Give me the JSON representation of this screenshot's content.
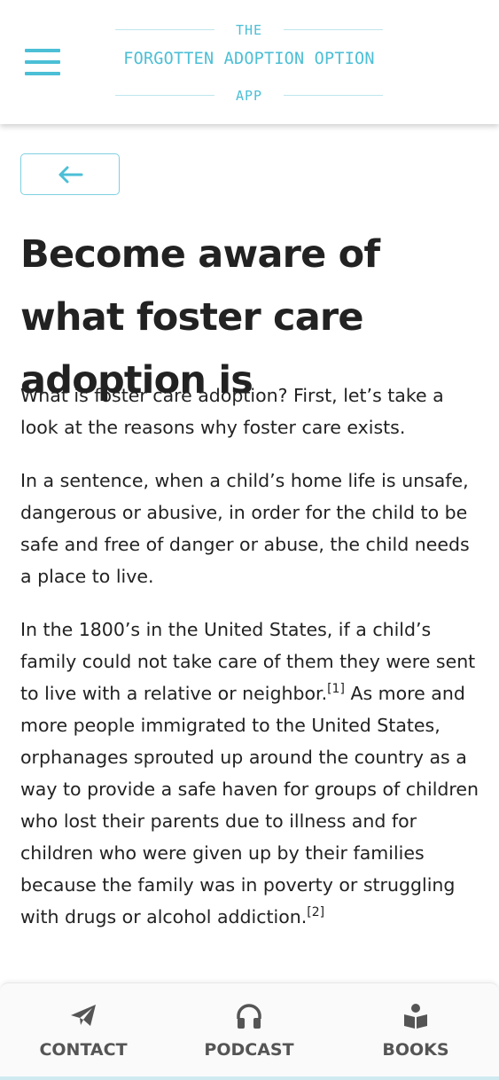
{
  "header": {
    "logo_top": "THE",
    "logo_main": "FORGOTTEN ADOPTION OPTION",
    "logo_bottom": "APP",
    "accent_color": "#4bbfd6",
    "menu_icon": "hamburger-menu-icon"
  },
  "back_button": {
    "icon": "arrow-left-icon"
  },
  "article": {
    "title": "Become aware of what foster care adoption is",
    "p1": "What is foster care adoption? First, let’s take a look at the reasons why foster care exists.",
    "p2": "In a sentence, when a child’s home life is unsafe, dangerous or abusive, in order for the child to be safe and free of danger or abuse, the child needs a place to live.",
    "p3_part1": "In the 1800’s in the United States, if a child’s family could not take care of them they were sent to live with a relative or neighbor.",
    "p3_ref1": "[1]",
    "p3_part2": " As more and more people immigrated to the United States, orphanages sprouted up around the country as a way to provide a safe haven for groups of children who lost their parents due to illness and for children who were given up by their families because the family was in poverty or struggling with drugs or alcohol addiction.",
    "p3_ref2": "[2]"
  },
  "bottom_nav": {
    "contact": {
      "label": "CONTACT",
      "icon": "paper-plane-icon"
    },
    "podcast": {
      "label": "PODCAST",
      "icon": "headphones-icon"
    },
    "books": {
      "label": "BOOKS",
      "icon": "book-reader-icon"
    }
  }
}
